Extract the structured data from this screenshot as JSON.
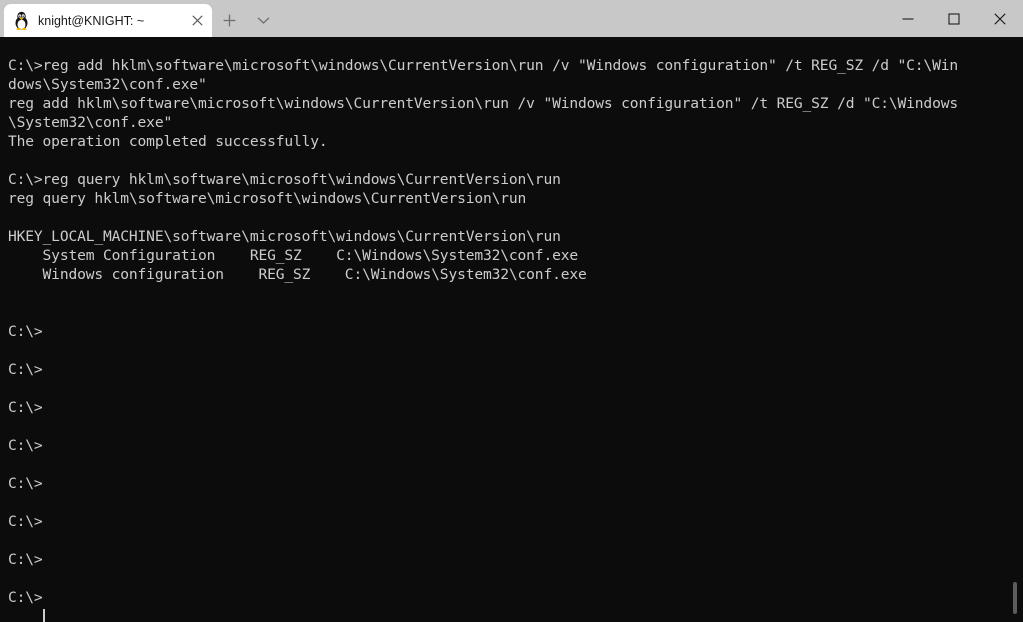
{
  "window": {
    "titlebar_bg": "#c8c8c8",
    "controls": [
      {
        "name": "minimize",
        "glyph": "─"
      },
      {
        "name": "maximize",
        "glyph": "□"
      },
      {
        "name": "close",
        "glyph": "✕"
      }
    ]
  },
  "tabbar": {
    "tabs": [
      {
        "title": "knight@KNIGHT: ~",
        "icon": "tux-penguin-icon",
        "close_glyph": "✕",
        "active": true
      }
    ],
    "new_tab_glyph": "+",
    "dropdown_glyph": "⌄"
  },
  "terminal": {
    "background": "#0c0c0c",
    "foreground": "#cccccc",
    "font_size_px": 14.6,
    "line_height_px": 19,
    "cursor": {
      "shape": "bar",
      "column": 4,
      "line": 30
    },
    "scrollbar_visible": true,
    "lines": [
      "",
      "C:\\>reg add hklm\\software\\microsoft\\windows\\CurrentVersion\\run /v \"Windows configuration\" /t REG_SZ /d \"C:\\Win",
      "dows\\System32\\conf.exe\"",
      "reg add hklm\\software\\microsoft\\windows\\CurrentVersion\\run /v \"Windows configuration\" /t REG_SZ /d \"C:\\Windows",
      "\\System32\\conf.exe\"",
      "The operation completed successfully.",
      "",
      "C:\\>reg query hklm\\software\\microsoft\\windows\\CurrentVersion\\run",
      "reg query hklm\\software\\microsoft\\windows\\CurrentVersion\\run",
      "",
      "HKEY_LOCAL_MACHINE\\software\\microsoft\\windows\\CurrentVersion\\run",
      "    System Configuration    REG_SZ    C:\\Windows\\System32\\conf.exe",
      "    Windows configuration    REG_SZ    C:\\Windows\\System32\\conf.exe",
      "",
      "",
      "C:\\>",
      "",
      "C:\\>",
      "",
      "C:\\>",
      "",
      "C:\\>",
      "",
      "C:\\>",
      "",
      "C:\\>",
      "",
      "C:\\>",
      "",
      "C:\\>"
    ]
  }
}
